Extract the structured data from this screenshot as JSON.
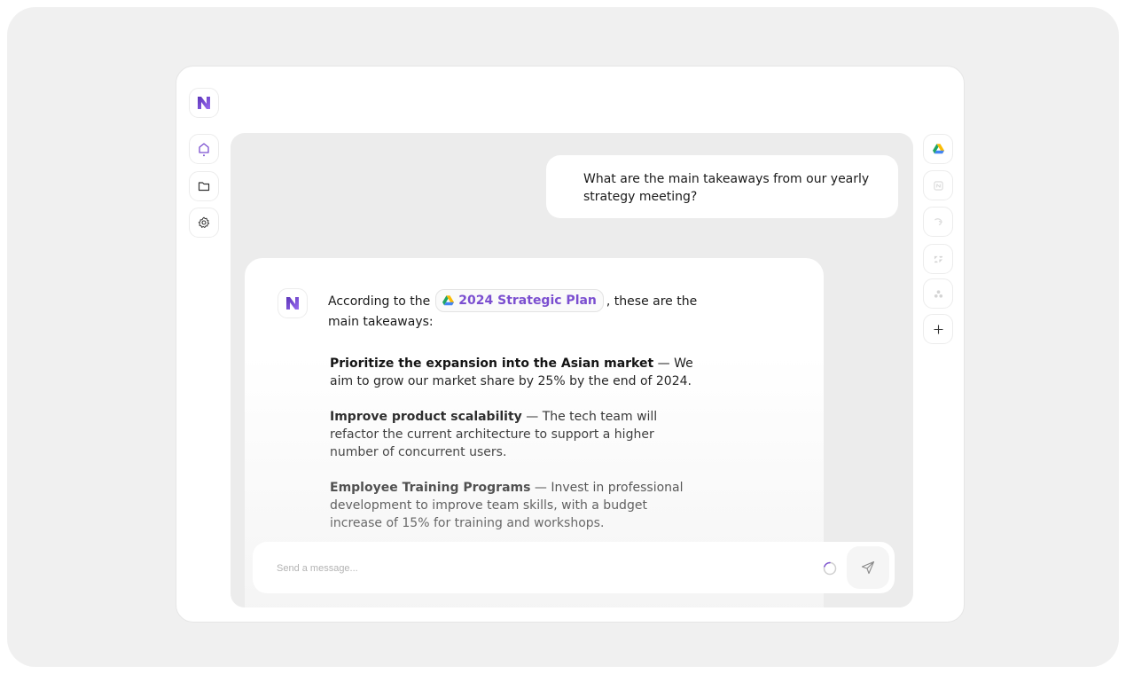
{
  "conversation": {
    "user_message": "What are the main takeaways from our yearly strategy meeting?",
    "ai_intro_before": "According to the",
    "ai_intro_after": ", these are the main takeaways:",
    "doc_chip_label": "2024 Strategic Plan",
    "takeaways": [
      {
        "title": "Prioritize the expansion into the Asian market",
        "body": " — We aim to grow our market share by 25% by the end of 2024."
      },
      {
        "title": "Improve product scalability",
        "body": " — The tech team will refactor the current architecture to support a higher number of concurrent users."
      },
      {
        "title": "Employee Training Programs",
        "body": " — Invest in professional development to improve team skills, with a budget increase of 15% for training and workshops."
      }
    ]
  },
  "composer": {
    "placeholder": "Send a message..."
  },
  "colors": {
    "brand": "#7b4fd0",
    "panel": "#ececec",
    "background": "#f0f0f0"
  },
  "icons": {
    "logo": "brand-logo-icon",
    "sidebar": [
      "home-icon",
      "folder-icon",
      "settings-gear-icon"
    ],
    "integrations": [
      "google-drive-icon",
      "notion-icon",
      "integration-2-icon",
      "zendesk-icon",
      "integration-4-icon",
      "add-icon"
    ],
    "composer": [
      "loading-spinner-icon",
      "send-icon"
    ]
  }
}
